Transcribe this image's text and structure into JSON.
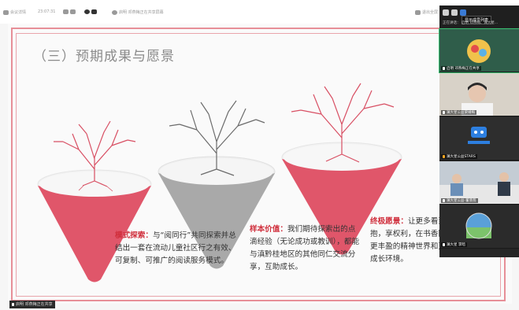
{
  "toolbar": {
    "item1": "会议详情",
    "item2": "23:07:31",
    "item3": "启明 邓燕梅正在共享屏幕",
    "right": "退出全屏"
  },
  "slide": {
    "title": "（三）预期成果与愿景",
    "blocks": [
      {
        "head": "模式探索：",
        "text": "与“阅同行”共同探索并总结出一套在流动儿童社区行之有效、可复制、可推广的阅读服务模式。"
      },
      {
        "head": "样本价值：",
        "text": "我们期待探索出的点滴经验（无论成功或教训），都能与滇黔桂地区的其他同仁交流分享，互助成长。"
      },
      {
        "head": "终极愿景：",
        "text": "让更多看到、被拥抱，享权利，在书香陪伴拥有更丰盈的精神世界和更友好的成长环境。"
      }
    ]
  },
  "share_tag": "启明 邓燕梅正在共享",
  "panel": {
    "tooltip": "显示成员列表",
    "names_line": "正在讲话：  启明 邓燕梅、澜大星...",
    "tiles": [
      {
        "label": "启明 邓燕梅正在共享"
      },
      {
        "label": "澜大星公益梁靖梅"
      },
      {
        "label": "澜大星公益STARS"
      },
      {
        "label": "澜大星公益-董翡翡"
      },
      {
        "label": "澜大星 李暗"
      }
    ]
  },
  "colors": {
    "accent": "#d0303d",
    "cone_red": "#e0566a",
    "cone_gray": "#a9a9a9",
    "frame": "#e78f98"
  }
}
